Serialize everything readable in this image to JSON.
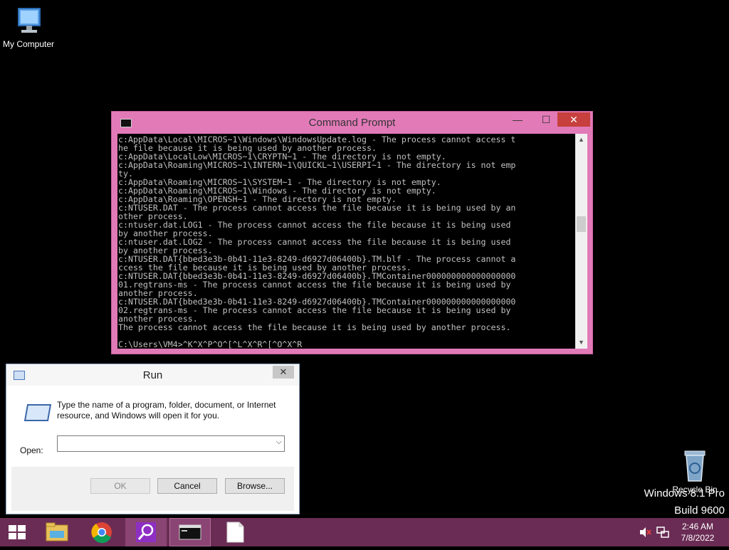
{
  "desktop": {
    "my_computer_label": "My Computer",
    "recycle_bin_label": "Recycle Bin",
    "watermark_line1": "Windows 8.1 Pro",
    "watermark_line2": "Build 9600"
  },
  "cmd": {
    "title": "Command Prompt",
    "minimize": "—",
    "maximize": "☐",
    "close": "✕",
    "output": "c:AppData\\Local\\MICROS~1\\Windows\\WindowsUpdate.log - The process cannot access t\nhe file because it is being used by another process.\nc:AppData\\LocalLow\\MICROS~1\\CRYPTN~1 - The directory is not empty.\nc:AppData\\Roaming\\MICROS~1\\INTERN~1\\QUICKL~1\\USERPI~1 - The directory is not emp\nty.\nc:AppData\\Roaming\\MICROS~1\\SYSTEM~1 - The directory is not empty.\nc:AppData\\Roaming\\MICROS~1\\Windows - The directory is not empty.\nc:AppData\\Roaming\\OPENSH~1 - The directory is not empty.\nc:NTUSER.DAT - The process cannot access the file because it is being used by an\nother process.\nc:ntuser.dat.LOG1 - The process cannot access the file because it is being used\nby another process.\nc:ntuser.dat.LOG2 - The process cannot access the file because it is being used\nby another process.\nc:NTUSER.DAT{bbed3e3b-0b41-11e3-8249-d6927d06400b}.TM.blf - The process cannot a\nccess the file because it is being used by another process.\nc:NTUSER.DAT{bbed3e3b-0b41-11e3-8249-d6927d06400b}.TMContainer000000000000000000\n01.regtrans-ms - The process cannot access the file because it is being used by\nanother process.\nc:NTUSER.DAT{bbed3e3b-0b41-11e3-8249-d6927d06400b}.TMContainer000000000000000000\n02.regtrans-ms - The process cannot access the file because it is being used by\nanother process.\nThe process cannot access the file because it is being used by another process.",
    "prompt": "C:\\Users\\VM4>^K^X^P^O^[^L^X^R^[^O^X^R_",
    "scroll_up": "▲",
    "scroll_down": "▼"
  },
  "run": {
    "title": "Run",
    "close": "✕",
    "description": "Type the name of a program, folder, document, or Internet resource, and Windows will open it for you.",
    "open_label": "Open:",
    "open_value": "",
    "combo_arrow": "⌵",
    "ok_label": "OK",
    "cancel_label": "Cancel",
    "browse_label": "Browse..."
  },
  "taskbar": {
    "clock_time": "2:46 AM",
    "clock_date": "7/8/2022"
  },
  "colors": {
    "accent_window": "#e27ab8",
    "taskbar": "#6a2c54",
    "close_red": "#c7403d"
  }
}
